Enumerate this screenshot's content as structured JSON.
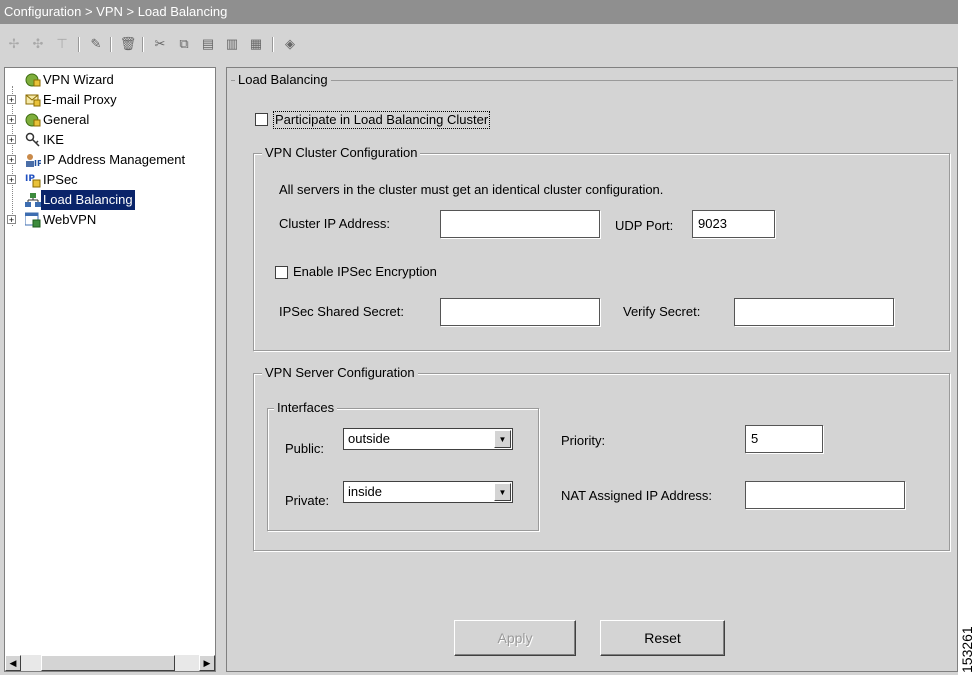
{
  "titlebar": {
    "breadcrumb": "Configuration > VPN > Load Balancing"
  },
  "toolbar": {
    "icons": [
      "add-icon",
      "add-child-icon",
      "insert-icon",
      "edit-icon",
      "delete-icon",
      "cut-icon",
      "copy-icon",
      "paste-icon",
      "paste-after-icon",
      "paste-before-icon",
      "find-icon"
    ]
  },
  "tree": {
    "items": [
      {
        "label": "VPN Wizard",
        "icon": "wizard-icon"
      },
      {
        "label": "E-mail Proxy",
        "icon": "email-icon"
      },
      {
        "label": "General",
        "icon": "general-icon"
      },
      {
        "label": "IKE",
        "icon": "ike-icon"
      },
      {
        "label": "IP Address Management",
        "icon": "ip-address-icon"
      },
      {
        "label": "IPSec",
        "icon": "ipsec-icon"
      },
      {
        "label": "Load Balancing",
        "icon": "load-balancing-icon",
        "selected": true
      },
      {
        "label": "WebVPN",
        "icon": "webvpn-icon"
      }
    ]
  },
  "panel": {
    "title": "Load Balancing",
    "participate_label": "Participate in Load Balancing Cluster",
    "participate_checked": false,
    "cluster": {
      "title": "VPN Cluster Configuration",
      "note": "All servers in the cluster must get an identical cluster configuration.",
      "ip_label": "Cluster IP Address:",
      "ip_value": "",
      "udp_label": "UDP Port:",
      "udp_value": "9023",
      "encrypt_label": "Enable IPSec Encryption",
      "encrypt_checked": false,
      "secret_label": "IPSec Shared Secret:",
      "secret_value": "",
      "verify_label": "Verify Secret:",
      "verify_value": ""
    },
    "server": {
      "title": "VPN Server Configuration",
      "interfaces_title": "Interfaces",
      "public_label": "Public:",
      "public_value": "outside",
      "private_label": "Private:",
      "private_value": "inside",
      "priority_label": "Priority:",
      "priority_value": "5",
      "nat_label": "NAT Assigned IP Address:",
      "nat_value": ""
    },
    "apply_label": "Apply",
    "reset_label": "Reset"
  },
  "figure_number": "153261",
  "colors": {
    "selection": "#0a246a",
    "panel": "#d4d4d4",
    "titlebar": "#8f8f8f"
  }
}
